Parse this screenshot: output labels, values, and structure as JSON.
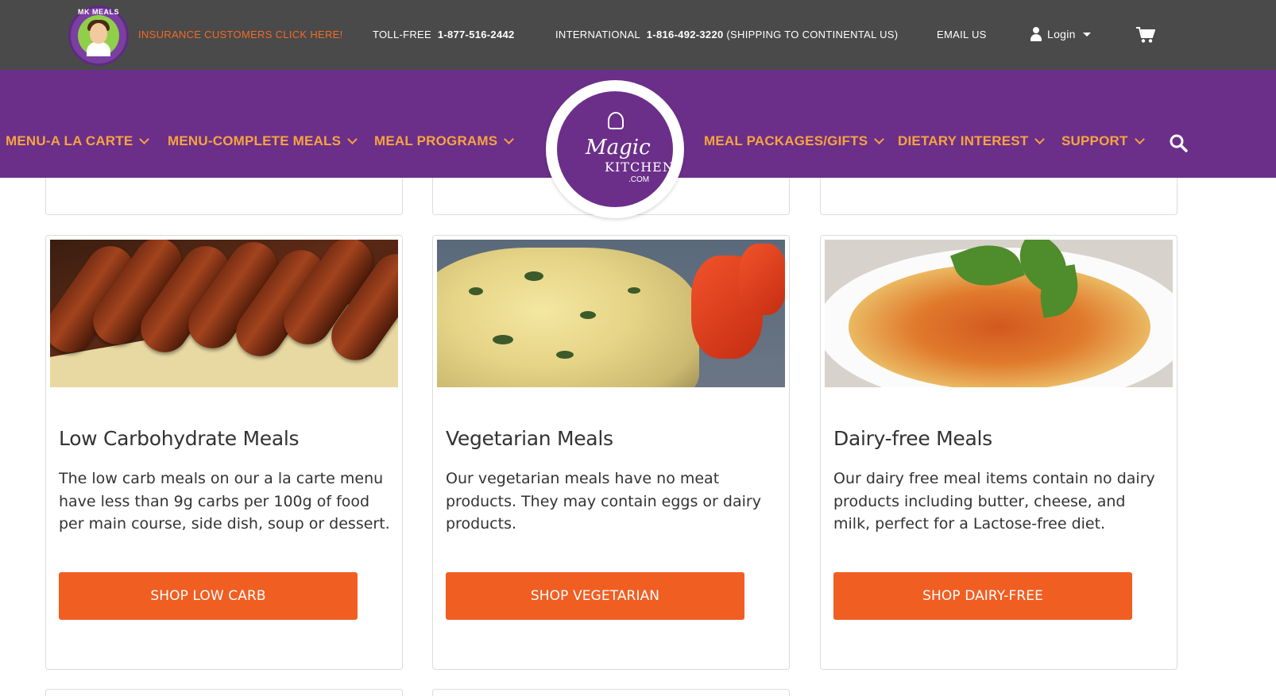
{
  "topbar": {
    "logo_text": "MK MEALS",
    "insurance": "INSURANCE CUSTOMERS CLICK HERE!",
    "tollfree_label": "TOLL-FREE",
    "tollfree_number": "1-877-516-2442",
    "intl_label": "INTERNATIONAL",
    "intl_number": "1-816-492-3220",
    "intl_note": "(SHIPPING TO CONTINENTAL US)",
    "email": "EMAIL US",
    "login": "Login",
    "icons": [
      "user-icon",
      "caret-down-icon",
      "cart-icon"
    ]
  },
  "nav": {
    "items": [
      "MENU-A LA CARTE",
      "MENU-COMPLETE MEALS",
      "MEAL PROGRAMS",
      "MEAL PACKAGES/GIFTS",
      "DIETARY INTEREST",
      "SUPPORT"
    ],
    "logo": {
      "word1": "Magic",
      "word2": "KITCHEN",
      "word3": ".COM"
    },
    "search_icon": "search-icon"
  },
  "colors": {
    "topbar": "#4a4a4a",
    "nav": "#6b2f8a",
    "nav_text": "#f7a440",
    "accent": "#f15e22",
    "insurance_text": "#f26a26"
  },
  "cards": [
    {
      "title": "Low Carbohydrate Meals",
      "description": "The low carb meals on our a la carte menu have less than 9g carbs per 100g of food per main course, side dish, soup or dessert.",
      "button": "SHOP LOW CARB"
    },
    {
      "title": "Vegetarian Meals",
      "description": "Our vegetarian meals have no meat products. They may contain eggs or dairy products.",
      "button": "SHOP VEGETARIAN"
    },
    {
      "title": "Dairy-free Meals",
      "description": "Our dairy free meal items contain no dairy products including butter, cheese, and milk, perfect for a Lactose-free diet.",
      "button": "SHOP DAIRY-FREE"
    }
  ]
}
